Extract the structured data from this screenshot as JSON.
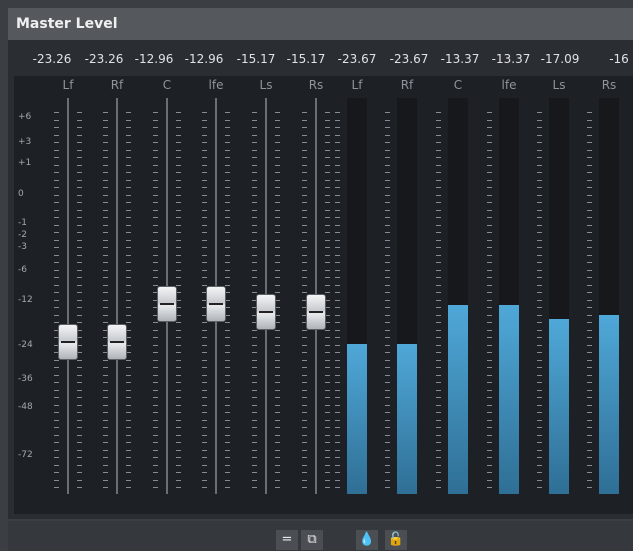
{
  "window": {
    "title": "Master Level"
  },
  "readouts": [
    "-23.26",
    "-23.26",
    "-12.96",
    "-12.96",
    "-15.17",
    "-15.17",
    "-23.67",
    "-23.67",
    "-13.37",
    "-13.37",
    "-17.09",
    "-16"
  ],
  "faders": [
    {
      "label": "Lf",
      "level_db": -23.26
    },
    {
      "label": "Rf",
      "level_db": -23.26
    },
    {
      "label": "C",
      "level_db": -12.96
    },
    {
      "label": "lfe",
      "level_db": -12.96
    },
    {
      "label": "Ls",
      "level_db": -15.17
    },
    {
      "label": "Rs",
      "level_db": -15.17
    }
  ],
  "meters": [
    {
      "label": "Lf",
      "peak_db": -23.67
    },
    {
      "label": "Rf",
      "peak_db": -23.67
    },
    {
      "label": "C",
      "peak_db": -13.37
    },
    {
      "label": "lfe",
      "peak_db": -13.37
    },
    {
      "label": "Ls",
      "peak_db": -17.09
    },
    {
      "label": "Rs",
      "peak_db": -16
    }
  ],
  "scale_labels": [
    "+6",
    "+3",
    "+1",
    "0",
    "-1",
    "-2",
    "-3",
    "-6",
    "-12",
    "-24",
    "-36",
    "-48",
    "-72"
  ],
  "footer_buttons": [
    {
      "name": "link-channels-icon",
      "glyph": "="
    },
    {
      "name": "window-icon",
      "glyph": "⧉"
    },
    {
      "name": "drop-icon",
      "glyph": "💧"
    },
    {
      "name": "lock-icon",
      "glyph": "🔓"
    }
  ],
  "colors": {
    "meter_fill": "#4fa8d8",
    "background": "#1d2024"
  }
}
